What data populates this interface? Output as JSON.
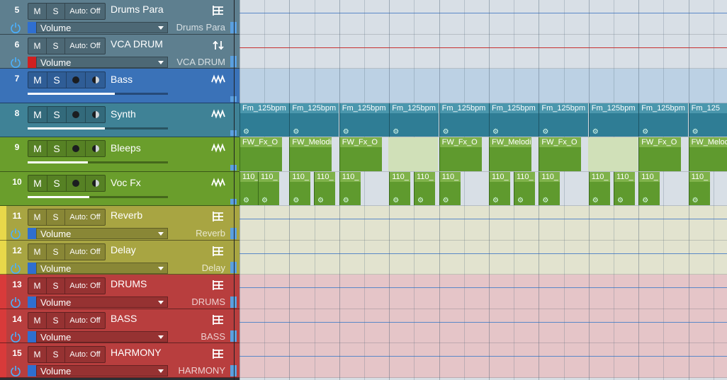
{
  "tracks": [
    {
      "num": "5",
      "type": "folder",
      "mute": "M",
      "solo": "S",
      "auto_state": "Auto: Off",
      "name": "Drums Para",
      "param": "Volume",
      "dest": "Drums Para",
      "color": "#5e7f8f",
      "label_color": "#5e7f8f",
      "swatch": "#2f6fd0",
      "icon": "folder-icon"
    },
    {
      "num": "6",
      "type": "vca",
      "mute": "M",
      "solo": "S",
      "auto_state": "Auto: Off",
      "name": "VCA DRUM",
      "param": "Volume",
      "dest": "VCA DRUM",
      "color": "#5e7f8f",
      "label_color": "#5e7f8f",
      "swatch": "#d02020",
      "icon": "vca-icon"
    },
    {
      "num": "7",
      "type": "instrument",
      "mute": "M",
      "solo": "S",
      "name": "Bass",
      "color": "#3a72b8",
      "label_color": "#3a72b8",
      "icon": "instrument-icon",
      "fader": 0.62
    },
    {
      "num": "8",
      "type": "instrument",
      "mute": "M",
      "solo": "S",
      "name": "Synth",
      "color": "#3f8296",
      "label_color": "#3f8296",
      "icon": "instrument-icon",
      "fader": 0.55
    },
    {
      "num": "9",
      "type": "instrument",
      "mute": "M",
      "solo": "S",
      "name": "Bleeps",
      "color": "#6a9e2c",
      "label_color": "#6a9e2c",
      "icon": "instrument-icon",
      "fader": 0.43
    },
    {
      "num": "10",
      "type": "instrument",
      "mute": "M",
      "solo": "S",
      "name": "Voc Fx",
      "color": "#6a9e2c",
      "label_color": "#6a9e2c",
      "icon": "instrument-icon",
      "fader": 0.44
    },
    {
      "num": "11",
      "type": "folder",
      "mute": "M",
      "solo": "S",
      "auto_state": "Auto: Off",
      "name": "Reverb",
      "param": "Volume",
      "dest": "Reverb",
      "color": "#a8a542",
      "label_color": "#e8d84a",
      "swatch": "#2f6fd0",
      "icon": "folder-icon"
    },
    {
      "num": "12",
      "type": "folder",
      "mute": "M",
      "solo": "S",
      "auto_state": "Auto: Off",
      "name": "Delay",
      "param": "Volume",
      "dest": "Delay",
      "color": "#a8a542",
      "label_color": "#e8d84a",
      "swatch": "#2f6fd0",
      "icon": "folder-icon"
    },
    {
      "num": "13",
      "type": "folder",
      "mute": "M",
      "solo": "S",
      "auto_state": "Auto: Off",
      "name": "DRUMS",
      "param": "Volume",
      "dest": "DRUMS",
      "color": "#b83e3e",
      "label_color": "#d83a3a",
      "swatch": "#2f6fd0",
      "icon": "folder-icon"
    },
    {
      "num": "14",
      "type": "folder",
      "mute": "M",
      "solo": "S",
      "auto_state": "Auto: Off",
      "name": "BASS",
      "param": "Volume",
      "dest": "BASS",
      "color": "#b83e3e",
      "label_color": "#d83a3a",
      "swatch": "#2f6fd0",
      "icon": "folder-icon"
    },
    {
      "num": "15",
      "type": "folder",
      "mute": "M",
      "solo": "S",
      "auto_state": "Auto: Off",
      "name": "HARMONY",
      "param": "Volume",
      "dest": "HARMONY",
      "color": "#b83e3e",
      "label_color": "#d83a3a",
      "swatch": "#2f6fd0",
      "icon": "folder-icon"
    }
  ],
  "lanes": [
    {
      "color": "#d8dfe6",
      "line_color": "#5a88c8"
    },
    {
      "color": "#d8dfe6",
      "line_color": "#c83030"
    },
    {
      "color": "#bcd1e4",
      "line_color": ""
    },
    {
      "color": "#d8dfe6",
      "line_color": ""
    },
    {
      "color": "#d8dfe6",
      "line_color": ""
    },
    {
      "color": "#d8dfe6",
      "line_color": ""
    },
    {
      "color": "#e2e3cf",
      "line_color": "#5a88c8"
    },
    {
      "color": "#e2e3cf",
      "line_color": "#5a88c8"
    },
    {
      "color": "#e5c5c8",
      "line_color": "#5a88c8"
    },
    {
      "color": "#e5c5c8",
      "line_color": "#5a88c8"
    },
    {
      "color": "#e5c5c8",
      "line_color": "#5a88c8"
    }
  ],
  "clips": {
    "synth": [
      "Fm_125bpm",
      "Fm_125bpm",
      "Fm_125bpm",
      "Fm_125bpm",
      "Fm_125bpm",
      "Fm_125bpm",
      "Fm_125bpm",
      "Fm_125bpm",
      "Fm_125bpm",
      "Fm_125"
    ],
    "bleeps": [
      "FW_Fx_O",
      "FW_Melodi",
      "FW_Fx_O",
      "FW_Fx_O",
      "FW_Melodi",
      "FW_Fx_O",
      "FW_Fx_O",
      "FW_Melodi"
    ],
    "vocfx": [
      "110_",
      "110_",
      "110_",
      "110_",
      "110_",
      "110_",
      "110_",
      "110_",
      "110_",
      "110_",
      "110_",
      "110_",
      "110_",
      "110_",
      "110_"
    ]
  },
  "colors": {
    "synth_clip": "#2f7d95",
    "green_clip": "#5f9a2e",
    "accent_blue": "#5aa0e0"
  }
}
